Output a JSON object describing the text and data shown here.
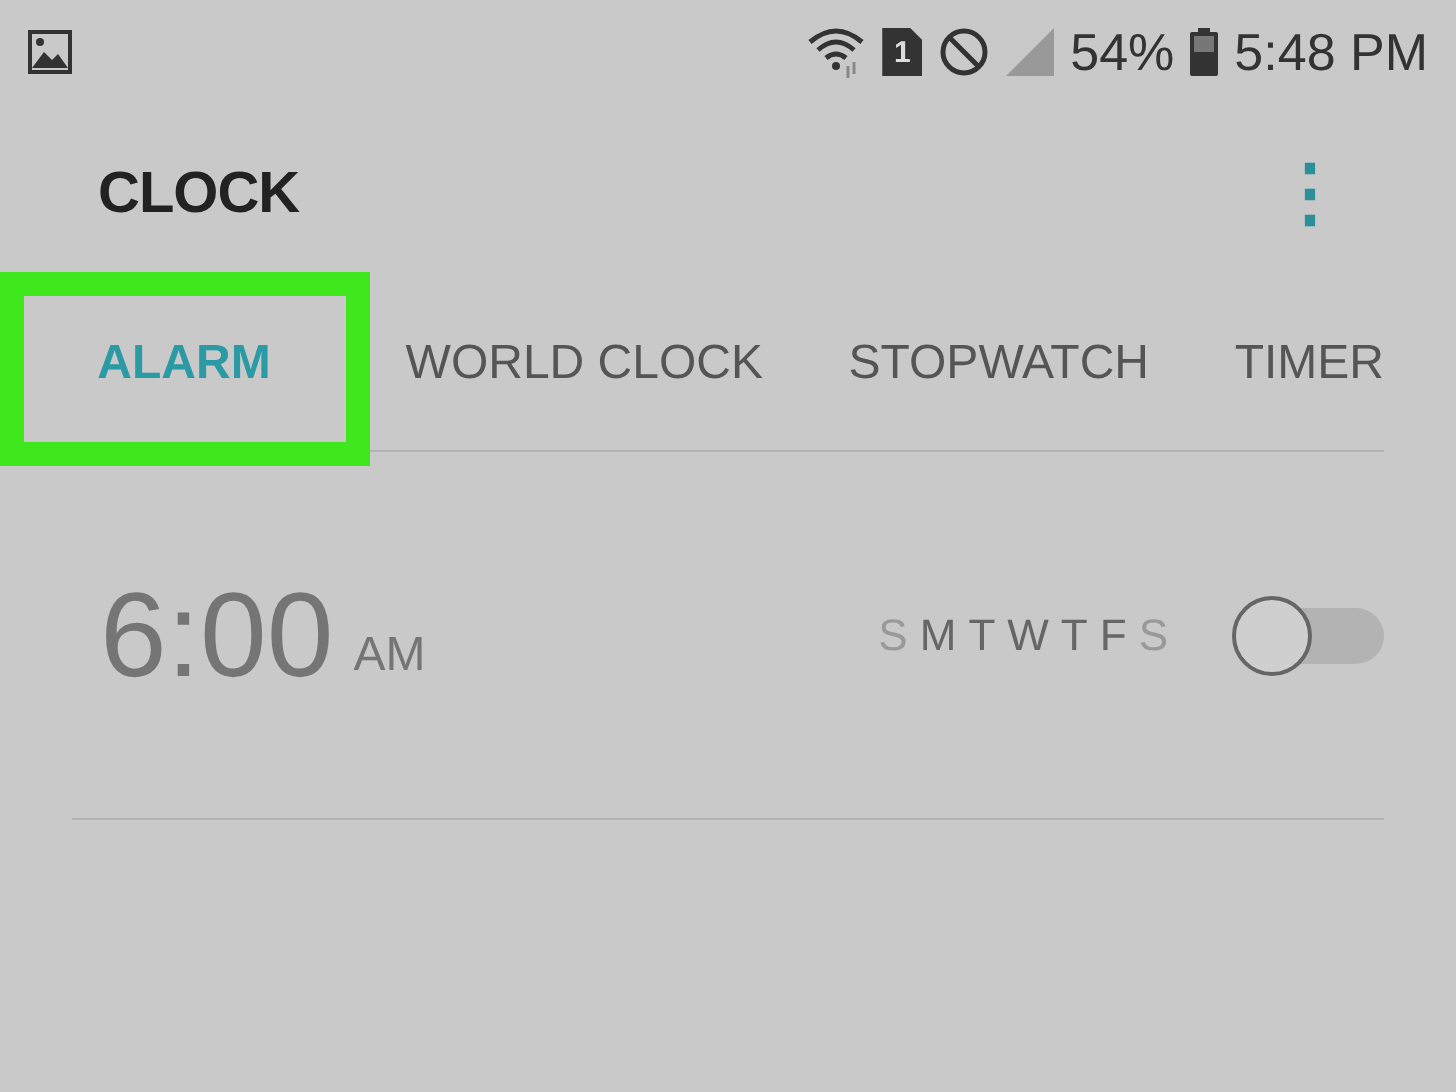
{
  "status_bar": {
    "sim_slot": "1",
    "battery": "54%",
    "time": "5:48 PM"
  },
  "app_bar": {
    "title": "CLOCK",
    "menu": "⋮"
  },
  "tabs": [
    {
      "label": "ALARM",
      "selected": true,
      "highlighted": true
    },
    {
      "label": "WORLD CLOCK",
      "selected": false,
      "highlighted": false
    },
    {
      "label": "STOPWATCH",
      "selected": false,
      "highlighted": false
    },
    {
      "label": "TIMER",
      "selected": false,
      "highlighted": false
    }
  ],
  "alarms": [
    {
      "time": "6:00",
      "period": "AM",
      "on": false,
      "days": [
        {
          "label": "S",
          "selected": false
        },
        {
          "label": "M",
          "selected": true
        },
        {
          "label": "T",
          "selected": true
        },
        {
          "label": "W",
          "selected": true
        },
        {
          "label": "T",
          "selected": true
        },
        {
          "label": "F",
          "selected": true
        },
        {
          "label": "S",
          "selected": false
        }
      ]
    }
  ]
}
